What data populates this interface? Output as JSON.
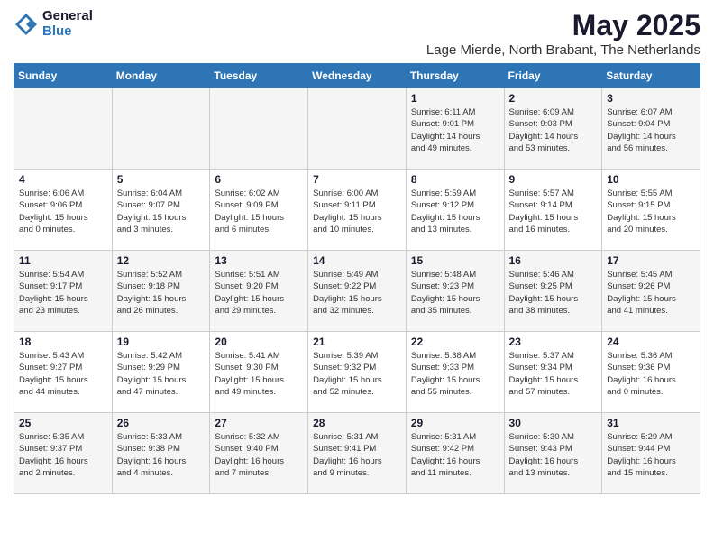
{
  "logo": {
    "general": "General",
    "blue": "Blue"
  },
  "header": {
    "month_year": "May 2025",
    "location": "Lage Mierde, North Brabant, The Netherlands"
  },
  "weekdays": [
    "Sunday",
    "Monday",
    "Tuesday",
    "Wednesday",
    "Thursday",
    "Friday",
    "Saturday"
  ],
  "rows": [
    [
      {
        "day": "",
        "lines": []
      },
      {
        "day": "",
        "lines": []
      },
      {
        "day": "",
        "lines": []
      },
      {
        "day": "",
        "lines": []
      },
      {
        "day": "1",
        "lines": [
          "Sunrise: 6:11 AM",
          "Sunset: 9:01 PM",
          "Daylight: 14 hours",
          "and 49 minutes."
        ]
      },
      {
        "day": "2",
        "lines": [
          "Sunrise: 6:09 AM",
          "Sunset: 9:03 PM",
          "Daylight: 14 hours",
          "and 53 minutes."
        ]
      },
      {
        "day": "3",
        "lines": [
          "Sunrise: 6:07 AM",
          "Sunset: 9:04 PM",
          "Daylight: 14 hours",
          "and 56 minutes."
        ]
      }
    ],
    [
      {
        "day": "4",
        "lines": [
          "Sunrise: 6:06 AM",
          "Sunset: 9:06 PM",
          "Daylight: 15 hours",
          "and 0 minutes."
        ]
      },
      {
        "day": "5",
        "lines": [
          "Sunrise: 6:04 AM",
          "Sunset: 9:07 PM",
          "Daylight: 15 hours",
          "and 3 minutes."
        ]
      },
      {
        "day": "6",
        "lines": [
          "Sunrise: 6:02 AM",
          "Sunset: 9:09 PM",
          "Daylight: 15 hours",
          "and 6 minutes."
        ]
      },
      {
        "day": "7",
        "lines": [
          "Sunrise: 6:00 AM",
          "Sunset: 9:11 PM",
          "Daylight: 15 hours",
          "and 10 minutes."
        ]
      },
      {
        "day": "8",
        "lines": [
          "Sunrise: 5:59 AM",
          "Sunset: 9:12 PM",
          "Daylight: 15 hours",
          "and 13 minutes."
        ]
      },
      {
        "day": "9",
        "lines": [
          "Sunrise: 5:57 AM",
          "Sunset: 9:14 PM",
          "Daylight: 15 hours",
          "and 16 minutes."
        ]
      },
      {
        "day": "10",
        "lines": [
          "Sunrise: 5:55 AM",
          "Sunset: 9:15 PM",
          "Daylight: 15 hours",
          "and 20 minutes."
        ]
      }
    ],
    [
      {
        "day": "11",
        "lines": [
          "Sunrise: 5:54 AM",
          "Sunset: 9:17 PM",
          "Daylight: 15 hours",
          "and 23 minutes."
        ]
      },
      {
        "day": "12",
        "lines": [
          "Sunrise: 5:52 AM",
          "Sunset: 9:18 PM",
          "Daylight: 15 hours",
          "and 26 minutes."
        ]
      },
      {
        "day": "13",
        "lines": [
          "Sunrise: 5:51 AM",
          "Sunset: 9:20 PM",
          "Daylight: 15 hours",
          "and 29 minutes."
        ]
      },
      {
        "day": "14",
        "lines": [
          "Sunrise: 5:49 AM",
          "Sunset: 9:22 PM",
          "Daylight: 15 hours",
          "and 32 minutes."
        ]
      },
      {
        "day": "15",
        "lines": [
          "Sunrise: 5:48 AM",
          "Sunset: 9:23 PM",
          "Daylight: 15 hours",
          "and 35 minutes."
        ]
      },
      {
        "day": "16",
        "lines": [
          "Sunrise: 5:46 AM",
          "Sunset: 9:25 PM",
          "Daylight: 15 hours",
          "and 38 minutes."
        ]
      },
      {
        "day": "17",
        "lines": [
          "Sunrise: 5:45 AM",
          "Sunset: 9:26 PM",
          "Daylight: 15 hours",
          "and 41 minutes."
        ]
      }
    ],
    [
      {
        "day": "18",
        "lines": [
          "Sunrise: 5:43 AM",
          "Sunset: 9:27 PM",
          "Daylight: 15 hours",
          "and 44 minutes."
        ]
      },
      {
        "day": "19",
        "lines": [
          "Sunrise: 5:42 AM",
          "Sunset: 9:29 PM",
          "Daylight: 15 hours",
          "and 47 minutes."
        ]
      },
      {
        "day": "20",
        "lines": [
          "Sunrise: 5:41 AM",
          "Sunset: 9:30 PM",
          "Daylight: 15 hours",
          "and 49 minutes."
        ]
      },
      {
        "day": "21",
        "lines": [
          "Sunrise: 5:39 AM",
          "Sunset: 9:32 PM",
          "Daylight: 15 hours",
          "and 52 minutes."
        ]
      },
      {
        "day": "22",
        "lines": [
          "Sunrise: 5:38 AM",
          "Sunset: 9:33 PM",
          "Daylight: 15 hours",
          "and 55 minutes."
        ]
      },
      {
        "day": "23",
        "lines": [
          "Sunrise: 5:37 AM",
          "Sunset: 9:34 PM",
          "Daylight: 15 hours",
          "and 57 minutes."
        ]
      },
      {
        "day": "24",
        "lines": [
          "Sunrise: 5:36 AM",
          "Sunset: 9:36 PM",
          "Daylight: 16 hours",
          "and 0 minutes."
        ]
      }
    ],
    [
      {
        "day": "25",
        "lines": [
          "Sunrise: 5:35 AM",
          "Sunset: 9:37 PM",
          "Daylight: 16 hours",
          "and 2 minutes."
        ]
      },
      {
        "day": "26",
        "lines": [
          "Sunrise: 5:33 AM",
          "Sunset: 9:38 PM",
          "Daylight: 16 hours",
          "and 4 minutes."
        ]
      },
      {
        "day": "27",
        "lines": [
          "Sunrise: 5:32 AM",
          "Sunset: 9:40 PM",
          "Daylight: 16 hours",
          "and 7 minutes."
        ]
      },
      {
        "day": "28",
        "lines": [
          "Sunrise: 5:31 AM",
          "Sunset: 9:41 PM",
          "Daylight: 16 hours",
          "and 9 minutes."
        ]
      },
      {
        "day": "29",
        "lines": [
          "Sunrise: 5:31 AM",
          "Sunset: 9:42 PM",
          "Daylight: 16 hours",
          "and 11 minutes."
        ]
      },
      {
        "day": "30",
        "lines": [
          "Sunrise: 5:30 AM",
          "Sunset: 9:43 PM",
          "Daylight: 16 hours",
          "and 13 minutes."
        ]
      },
      {
        "day": "31",
        "lines": [
          "Sunrise: 5:29 AM",
          "Sunset: 9:44 PM",
          "Daylight: 16 hours",
          "and 15 minutes."
        ]
      }
    ]
  ]
}
